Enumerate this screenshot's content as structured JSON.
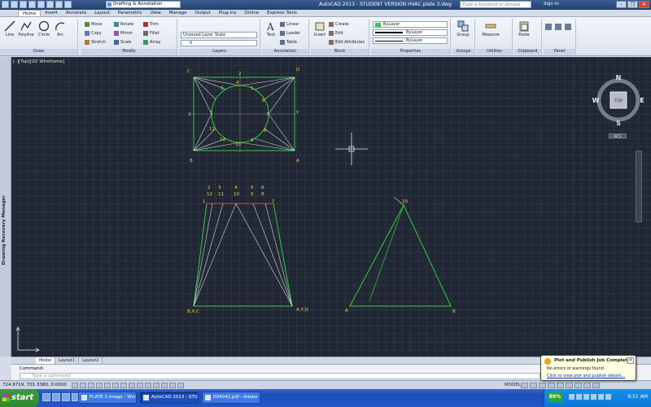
{
  "titlebar": {
    "workspace": "Drafting & Annotation",
    "title": "AutoCAD 2013 - STUDENT VERSION    HVAC plate 3.dwg",
    "search_placeholder": "Type a keyword or phrase",
    "signin": "Sign In",
    "minimize": "–",
    "restore": "❐",
    "close": "✕"
  },
  "ribbon_tabs": [
    "Home",
    "Insert",
    "Annotate",
    "Layout",
    "Parametric",
    "View",
    "Manage",
    "Output",
    "Plug-ins",
    "Online",
    "Express Tools"
  ],
  "ribbon": {
    "draw": {
      "title": "Draw",
      "line": "Line",
      "polyline": "Polyline",
      "circle": "Circle",
      "arc": "Arc"
    },
    "modify": {
      "title": "Modify",
      "move": "Move",
      "copy": "Copy",
      "stretch": "Stretch",
      "rotate": "Rotate",
      "mirror": "Mirror",
      "scale": "Scale",
      "trim": "Trim",
      "fillet": "Fillet",
      "array": "Array"
    },
    "layers": {
      "title": "Layers",
      "state": "Unsaved Layer State",
      "current": "0"
    },
    "annotation": {
      "title": "Annotation",
      "text": "Text",
      "linear": "Linear",
      "leader": "Leader",
      "table": "Table"
    },
    "block": {
      "title": "Block",
      "insert": "Insert",
      "create": "Create",
      "edit": "Edit",
      "edit_attributes": "Edit Attributes"
    },
    "properties": {
      "title": "Properties",
      "color": "ByLayer",
      "lineweight": "ByLayer",
      "linetype": "ByLayer"
    },
    "groups": {
      "title": "Groups",
      "group": "Group"
    },
    "utilities": {
      "title": "Utilities",
      "measure": "Measure"
    },
    "clipboard": {
      "title": "Clipboard",
      "paste": "Paste"
    },
    "panel": {
      "title": "Panel"
    }
  },
  "drawing": {
    "viewport_label": "[–][Top][2D Wireframe]",
    "palette_label": "Drawing Recovery Manager",
    "viewcube": {
      "n": "N",
      "s": "S",
      "e": "E",
      "w": "W",
      "face": "TOP"
    },
    "wcs": "WCS",
    "labels": {
      "C": "C",
      "D": "D",
      "B": "B",
      "A": "A",
      "X": "X",
      "Y": "Y",
      "n1": "1",
      "n2": "2",
      "n3": "3",
      "n4": "4",
      "n5": "5",
      "n6": "6",
      "n7": "7",
      "n8": "8",
      "n9": "9",
      "n10": "10",
      "n11": "11",
      "n12": "12",
      "bxc": "B,X,C",
      "ayd": "A,Y,D",
      "dev_top": [
        "2",
        "3",
        "4",
        "5",
        "6"
      ],
      "dev_top2": [
        "12",
        "11",
        "10",
        "9",
        "8"
      ],
      "dev_1": "1",
      "dev_7": "7",
      "tri_10": "10",
      "tri_A": "A",
      "tri_B": "B"
    }
  },
  "layout_tabs": [
    "Model",
    "Layout1",
    "Layout2"
  ],
  "command": {
    "history": "Command:",
    "placeholder": "Type a command"
  },
  "status": {
    "coords": "724.9719, 701.3380, 0.0000",
    "model": "MODEL"
  },
  "balloon": {
    "title": "Plot and Publish Job Complete",
    "line1": "No errors or warnings found",
    "link": "Click to view plot and publish details..."
  },
  "taskbar": {
    "start": "start",
    "tasks": [
      "PLATE 3 image - Wind...",
      "AutoCAD 2013 - STU...",
      "094042.pdf - Adobe ..."
    ],
    "battery": "89%",
    "clock": "9:51 AM"
  },
  "colors": {
    "drawing_bg": "#212834",
    "green": "#2ecc40",
    "yellow": "#e5d54a",
    "white_lines": "#d8d8d8",
    "red_ticks": "#e04040"
  }
}
